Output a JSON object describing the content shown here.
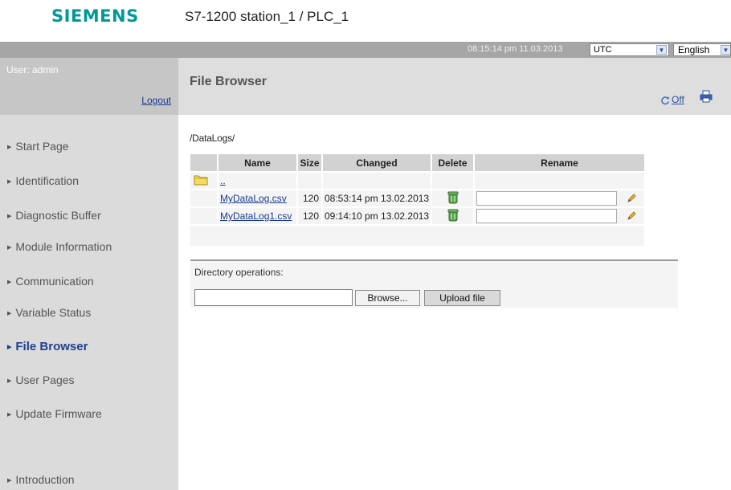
{
  "header": {
    "logo_text": "SIEMENS",
    "station_title": "S7-1200 station_1 / PLC_1"
  },
  "topbar": {
    "datetime": "08:15:14 pm  11.03.2013",
    "timezone_value": "UTC",
    "language_value": "English"
  },
  "sidebar": {
    "user_label": "User: admin",
    "logout_label": "Logout",
    "items": [
      {
        "label": "Start Page",
        "active": false
      },
      {
        "label": "Identification",
        "active": false
      },
      {
        "label": "Diagnostic Buffer",
        "active": false
      },
      {
        "label": "Module Information",
        "active": false
      },
      {
        "label": "Communication",
        "active": false
      },
      {
        "label": "Variable Status",
        "active": false
      },
      {
        "label": "File Browser",
        "active": true
      },
      {
        "label": "User Pages",
        "active": false
      },
      {
        "label": "Update Firmware",
        "active": false
      },
      {
        "label": "Introduction",
        "active": false
      }
    ]
  },
  "content": {
    "title": "File Browser",
    "refresh_label": "Off",
    "path": "/DataLogs/",
    "table": {
      "columns": [
        "Name",
        "Size",
        "Changed",
        "Delete",
        "Rename"
      ],
      "parent_link": "..",
      "rows": [
        {
          "name": "MyDataLog.csv",
          "size": "120",
          "changed": "08:53:14 pm 13.02.2013",
          "rename_value": ""
        },
        {
          "name": "MyDataLog1.csv",
          "size": "120",
          "changed": "09:14:10 pm 13.02.2013",
          "rename_value": ""
        }
      ]
    },
    "directory_operations_label": "Directory operations:",
    "browse_label": "Browse...",
    "upload_label": "Upload file"
  },
  "colors": {
    "brand": "#009999",
    "topbar": "#a6a6a6",
    "sidebar": "#dbdbdb",
    "link": "#1a3b8c"
  },
  "icons": {
    "folder": "folder-icon",
    "trash": "trash-icon",
    "pencil": "pencil-icon",
    "refresh": "refresh-icon",
    "print": "print-icon"
  }
}
